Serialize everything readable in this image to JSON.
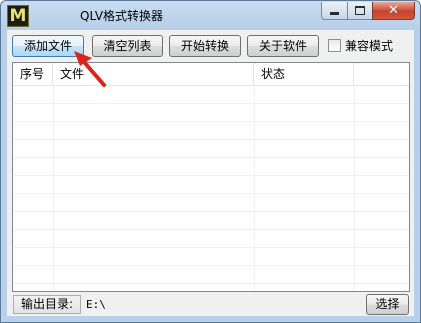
{
  "window": {
    "title": "QLV格式转换器",
    "icon_letter": "M"
  },
  "toolbar": {
    "add_file": "添加文件",
    "clear_list": "清空列表",
    "start_convert": "开始转换",
    "about": "关于软件",
    "compat_mode": "兼容模式",
    "compat_checked": false
  },
  "list": {
    "columns": [
      "序号",
      "文件",
      "状态"
    ],
    "rows": []
  },
  "output": {
    "label": "输出目录:",
    "path": "E:\\",
    "choose": "选择"
  },
  "colors": {
    "annotation_arrow": "#d8251e"
  }
}
